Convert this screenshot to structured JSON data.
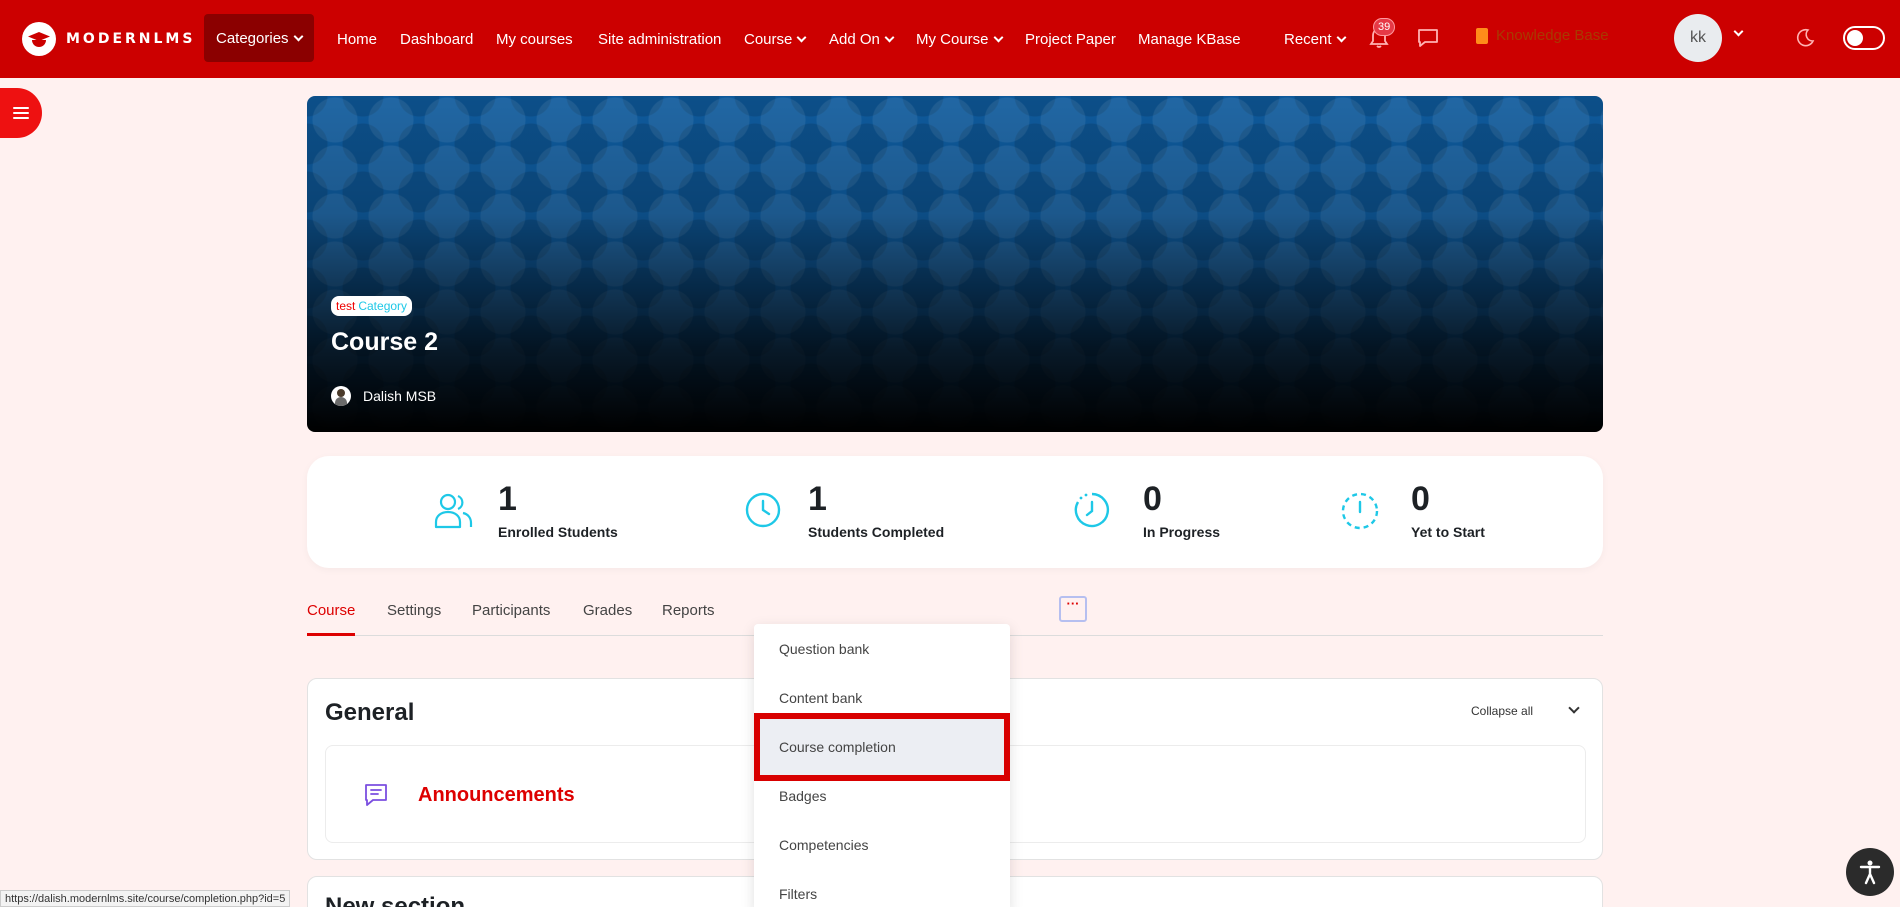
{
  "brand": {
    "name": "MODERNLMS"
  },
  "nav": {
    "categories": "Categories",
    "home": "Home",
    "dashboard": "Dashboard",
    "my_courses": "My courses",
    "site_admin": "Site administration",
    "course": "Course",
    "add_on": "Add On",
    "my_course": "My Course",
    "project_paper": "Project Paper",
    "manage_kbase": "Manage KBase",
    "recent": "Recent",
    "notification_count": "39",
    "knowledge_base": "Knowledge Base",
    "avatar_initials": "kk"
  },
  "hero": {
    "category_prefix": "test",
    "category_suffix": "Category",
    "title": "Course 2",
    "author": "Dalish MSB"
  },
  "stats": [
    {
      "value": "1",
      "label": "Enrolled Students",
      "icon": "users-icon"
    },
    {
      "value": "1",
      "label": "Students Completed",
      "icon": "clock-icon"
    },
    {
      "value": "0",
      "label": "In Progress",
      "icon": "progress-clock-icon"
    },
    {
      "value": "0",
      "label": "Yet to Start",
      "icon": "dashed-clock-icon"
    }
  ],
  "tabs": {
    "course": "Course",
    "settings": "Settings",
    "participants": "Participants",
    "grades": "Grades",
    "reports": "Reports",
    "more": "···"
  },
  "dropdown": {
    "items": [
      "Question bank",
      "Content bank",
      "Course completion",
      "Badges",
      "Competencies",
      "Filters"
    ]
  },
  "general": {
    "title": "General",
    "collapse_all": "Collapse all",
    "activity_name": "Announcements"
  },
  "section2": {
    "title": "New section"
  },
  "status_url": "https://dalish.modernlms.site/course/completion.php?id=5",
  "colors": {
    "brand": "#cc0000",
    "accent": "#1ec8e7",
    "highlight": "#d80000"
  }
}
